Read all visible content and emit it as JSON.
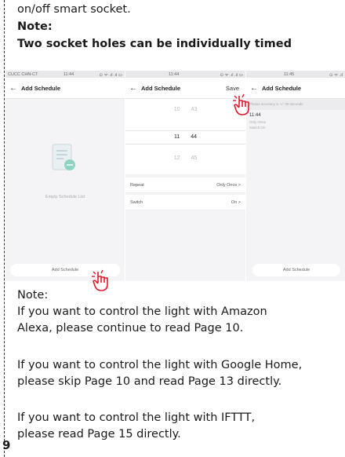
{
  "intro_tail": "on/off smart socket.",
  "note_label": "Note:",
  "note_text": "Two socket holes can be individually timed",
  "screens": {
    "s1": {
      "status_left": "CUCC CHN-CT",
      "status_time": "11:44",
      "status_right": "⊙ ᯤ .ıl .ıl ▭",
      "title": "Add Schedule",
      "empty_text": "Empty Schedule List",
      "button": "Add Schedule"
    },
    "s2": {
      "status_time": "11:44",
      "status_right": "⊙ ᯤ .ıl .ıl ▭",
      "title": "Add Schedule",
      "save": "Save",
      "picker": [
        {
          "hour": "10",
          "minute": "43"
        },
        {
          "hour": "11",
          "minute": "44"
        },
        {
          "hour": "12",
          "minute": "45"
        }
      ],
      "repeat_label": "Repeat",
      "repeat_value": "Only Once  >",
      "switch_label": "Switch",
      "switch_value": "On  >"
    },
    "s3": {
      "status_time": "11:45",
      "status_right": "⊙ ᯤ .ıl",
      "title": "Add Schedule",
      "banner": "Please accuracy is +/- 30 seconds",
      "item_time": "11:44",
      "item_repeat": "Only Once",
      "item_switch": "Switch:On",
      "button": "Add Schedule"
    }
  },
  "note2_label": "Note:",
  "para1_line1": "If you want to control the light with Amazon",
  "para1_line2": "Alexa, please continue to read Page 10.",
  "para2_line1": "If you want to control the light with Google Home,",
  "para2_line2": "please skip Page 10 and read Page 13 directly.",
  "para3_line1": "If you want to control the light with IFTTT,",
  "para3_line2": "please read Page 15 directly.",
  "page_number": "9"
}
